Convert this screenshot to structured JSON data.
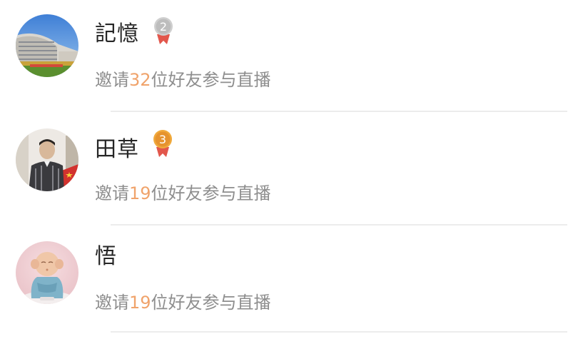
{
  "colors": {
    "name": "#262626",
    "desc": "#8e8e8e",
    "highlight": "#f0a36b",
    "divider": "#ececec",
    "medal_silver": "#c8c8c8",
    "medal_bronze": "#e6932e",
    "ribbon": "#e2574c"
  },
  "rows": [
    {
      "name": "記憶",
      "avatar_icon": "building-photo-avatar",
      "medal_icon": "silver-medal-icon",
      "medal_rank": "2",
      "desc_prefix": "邀请",
      "count": "32",
      "desc_suffix": "位好友参与直播"
    },
    {
      "name": "田草",
      "avatar_icon": "person-photo-avatar",
      "medal_icon": "bronze-medal-icon",
      "medal_rank": "3",
      "desc_prefix": "邀请",
      "count": "19",
      "desc_suffix": "位好友参与直播"
    },
    {
      "name": "悟",
      "avatar_icon": "monk-figurine-avatar",
      "desc_prefix": "邀请",
      "count": "19",
      "desc_suffix": "位好友参与直播"
    }
  ]
}
